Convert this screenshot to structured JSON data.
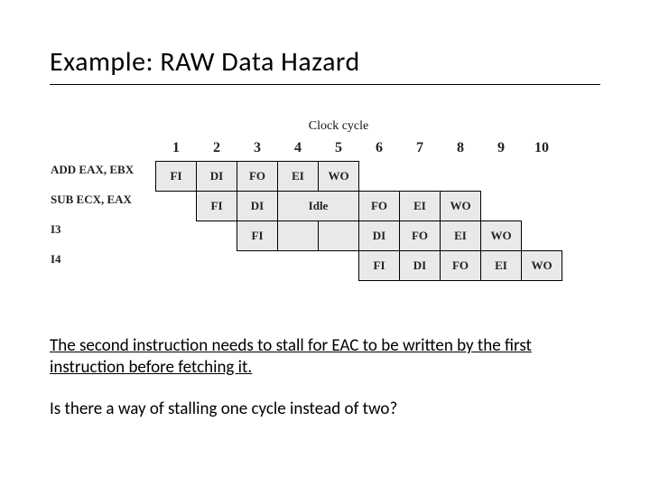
{
  "title": "Example: RAW Data Hazard",
  "chart_data": {
    "type": "table",
    "title": "Clock cycle",
    "categories": [
      "1",
      "2",
      "3",
      "4",
      "5",
      "6",
      "7",
      "8",
      "9",
      "10"
    ],
    "series": [
      {
        "name": "ADD EAX, EBX",
        "values": [
          "FI",
          "DI",
          "FO",
          "EI",
          "WO",
          "",
          "",
          "",
          "",
          ""
        ]
      },
      {
        "name": "SUB ECX, EAX",
        "values": [
          "",
          "FI",
          "DI",
          "Idle",
          "Idle",
          "FO",
          "EI",
          "WO",
          "",
          ""
        ]
      },
      {
        "name": "I3",
        "values": [
          "",
          "",
          "FI",
          "",
          "",
          "DI",
          "FO",
          "EI",
          "WO",
          ""
        ]
      },
      {
        "name": "I4",
        "values": [
          "",
          "",
          "",
          "",
          "",
          "FI",
          "DI",
          "FO",
          "EI",
          "WO"
        ]
      }
    ],
    "annotations": {
      "idle_span_row2": [
        4,
        5
      ]
    }
  },
  "labels": {
    "stage": {
      "FI": "FI",
      "DI": "DI",
      "FO": "FO",
      "EI": "EI",
      "WO": "WO",
      "Idle": "Idle"
    }
  },
  "body": {
    "p1": "The second instruction needs to stall for EAC to be written by the first instruction before fetching it.",
    "p2": "Is there a way of stalling one cycle instead of two?"
  }
}
